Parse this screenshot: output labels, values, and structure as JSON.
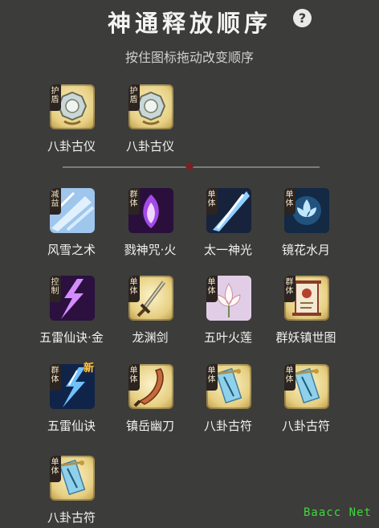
{
  "header": {
    "title": "神通释放顺序",
    "help_label": "?",
    "subtitle": "按住图标拖动改变顺序"
  },
  "skills": [
    {
      "tag": "护盾",
      "label": "八卦古仪",
      "order": "1",
      "icon": "bagua-compass-icon",
      "style": "gold"
    },
    {
      "tag": "护盾",
      "label": "八卦古仪",
      "order": "2",
      "icon": "bagua-compass-icon",
      "style": "gold"
    },
    {
      "tag": "减益",
      "label": "风雪之术",
      "order": "4",
      "icon": "ice-storm-icon",
      "style": "dark"
    },
    {
      "tag": "群体",
      "label": "戮神咒·火",
      "order": "5",
      "icon": "purple-flame-icon",
      "style": "dark"
    },
    {
      "tag": "单体",
      "label": "太一神光",
      "order": "6",
      "icon": "light-beam-icon",
      "style": "dark"
    },
    {
      "tag": "单体",
      "label": "镜花水月",
      "order": "7",
      "icon": "water-lotus-icon",
      "style": "dark"
    },
    {
      "tag": "控制",
      "label": "五雷仙诀·金",
      "order": "8",
      "icon": "purple-lightning-icon",
      "style": "dark"
    },
    {
      "tag": "单体",
      "label": "龙渊剑",
      "order": "9",
      "icon": "sword-icon",
      "style": "gold"
    },
    {
      "tag": "单体",
      "label": "五叶火莲",
      "order": "10",
      "icon": "fire-lotus-icon",
      "style": "gold"
    },
    {
      "tag": "群体",
      "label": "群妖镇世图",
      "order": "11",
      "icon": "scroll-icon",
      "style": "gold"
    },
    {
      "tag": "群体",
      "label": "五雷仙诀",
      "order": "12",
      "icon": "blue-lightning-icon",
      "style": "dark",
      "badge": "新"
    },
    {
      "tag": "单体",
      "label": "镇岳幽刀",
      "order": "13",
      "icon": "saber-icon",
      "style": "gold"
    },
    {
      "tag": "单体",
      "label": "八卦古符",
      "order": "14",
      "icon": "talisman-icon",
      "style": "gold"
    },
    {
      "tag": "单体",
      "label": "八卦古符",
      "order": "15",
      "icon": "talisman-icon",
      "style": "gold"
    },
    {
      "tag": "单体",
      "label": "八卦古符",
      "order": "15",
      "icon": "talisman-icon",
      "style": "gold"
    }
  ],
  "watermark": "Baacc Net",
  "colors": {
    "background": "#3c3c3a",
    "card_gold": "#e6cf82",
    "card_dark": "#141821",
    "tag_bg": "#2c2421",
    "new_badge": "#f7c64a",
    "watermark": "#3fd93a"
  }
}
